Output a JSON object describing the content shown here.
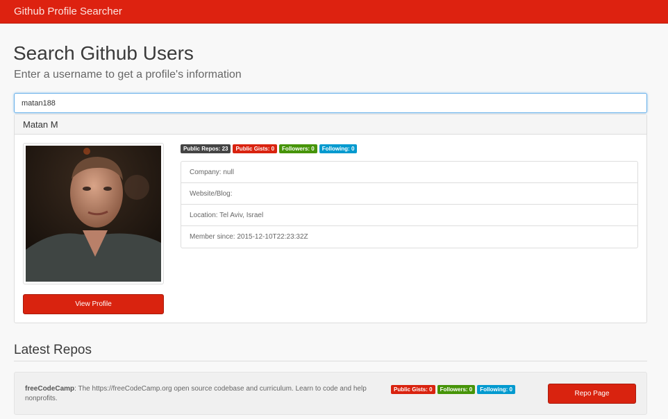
{
  "navbar": {
    "brand": "Github Profile Searcher"
  },
  "header": {
    "title": "Search Github Users",
    "subtitle": "Enter a username to get a profile's information"
  },
  "search": {
    "value": "matan188"
  },
  "profile": {
    "name": "Matan M",
    "avatar_alt": "avatar",
    "badges": {
      "public_repos": "Public Repos: 23",
      "public_gists": "Public Gists: 0",
      "followers": "Followers: 0",
      "following": "Following: 0"
    },
    "info": {
      "company": "Company: null",
      "website": "Website/Blog:",
      "location": "Location: Tel Aviv, Israel",
      "member_since": "Member since: 2015-12-10T22:23:32Z"
    },
    "view_profile_label": "View Profile"
  },
  "repos": {
    "title": "Latest Repos",
    "items": [
      {
        "name": "freeCodeCamp",
        "description": ": The https://freeCodeCamp.org open source codebase and curriculum. Learn to code and help nonprofits.",
        "badges": {
          "public_gists": "Public Gists: 0",
          "followers": "Followers: 0",
          "following": "Following: 0"
        },
        "button_label": "Repo Page"
      }
    ]
  },
  "colors": {
    "brand_red": "#dd2210",
    "badge_dark": "#444444",
    "badge_red": "#d9230f",
    "badge_green": "#469408",
    "badge_blue": "#029acf"
  }
}
